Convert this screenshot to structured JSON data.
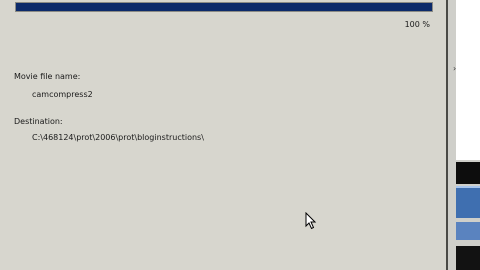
{
  "progress": {
    "percent_value": 100,
    "percent_label": "100 %"
  },
  "fields": {
    "movie_label": "Movie file name:",
    "movie_value": "camcompress2",
    "destination_label": "Destination:",
    "destination_value": "C:\\468124\\prot\\2006\\prot\\bloginstructions\\"
  },
  "colors": {
    "progress_fill": "#0c2a6a",
    "dialog_bg": "#d7d6ce"
  },
  "icons": {
    "cursor": "mouse-pointer-icon",
    "strip_arrow": "chevron-right-icon"
  }
}
